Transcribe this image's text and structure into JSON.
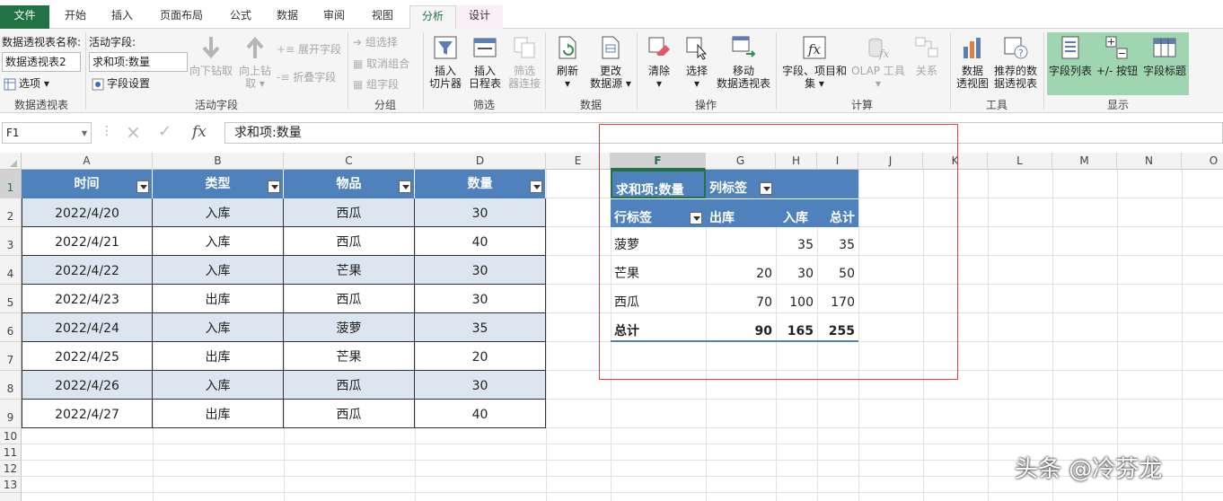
{
  "tabs": [
    "文件",
    "开始",
    "插入",
    "页面布局",
    "公式",
    "数据",
    "审阅",
    "视图",
    "分析",
    "设计"
  ],
  "ribbon": {
    "pivot_name_label": "数据透视表名称:",
    "pivot_name_value": "数据透视表2",
    "options_label": "选项",
    "group_pivot": "数据透视表",
    "active_field_label": "活动字段:",
    "active_field_value": "求和项:数量",
    "field_settings": "字段设置",
    "drill_down": "向下钻取",
    "drill_up_1": "向上钻",
    "drill_up_2": "取",
    "expand_field": "展开字段",
    "collapse_field": "折叠字段",
    "group_active_field": "活动字段",
    "group_selection": "组选择",
    "ungroup": "取消组合",
    "group_field": "组字段",
    "group_group": "分组",
    "insert_slicer_1": "插入",
    "insert_slicer_2": "切片器",
    "insert_timeline_1": "插入",
    "insert_timeline_2": "日程表",
    "filter_conn_1": "筛选",
    "filter_conn_2": "器连接",
    "group_filter": "筛选",
    "refresh": "刷新",
    "change_source_1": "更改",
    "change_source_2": "数据源",
    "group_data": "数据",
    "clear": "清除",
    "select": "选择",
    "move_1": "移动",
    "move_2": "数据透视表",
    "group_actions": "操作",
    "fields_items_1": "字段、项目和",
    "fields_items_2": "集",
    "olap_tools": "OLAP 工具",
    "relationships": "关系",
    "group_calc": "计算",
    "pivot_chart_1": "数据",
    "pivot_chart_2": "透视图",
    "recommended_1": "推荐的数",
    "recommended_2": "据透视表",
    "group_tools": "工具",
    "field_list": "字段列表",
    "plus_minus": "+/- 按钮",
    "field_headers": "字段标题",
    "group_show": "显示"
  },
  "formula_bar": {
    "name_box": "F1",
    "cancel_icon": "×",
    "enter_icon": "✓",
    "fx": "fx",
    "formula": "求和项:数量"
  },
  "columns": [
    "A",
    "B",
    "C",
    "D",
    "E",
    "F",
    "G",
    "H",
    "I",
    "J",
    "K",
    "L",
    "M",
    "N",
    "O"
  ],
  "rows": [
    "1",
    "2",
    "3",
    "4",
    "5",
    "6",
    "7",
    "8",
    "9",
    "10",
    "11",
    "12",
    "13"
  ],
  "source_table": {
    "headers": [
      "时间",
      "类型",
      "物品",
      "数量"
    ],
    "rows": [
      [
        "2022/4/20",
        "入库",
        "西瓜",
        "30"
      ],
      [
        "2022/4/21",
        "入库",
        "西瓜",
        "40"
      ],
      [
        "2022/4/22",
        "入库",
        "芒果",
        "30"
      ],
      [
        "2022/4/23",
        "出库",
        "西瓜",
        "30"
      ],
      [
        "2022/4/24",
        "入库",
        "菠萝",
        "35"
      ],
      [
        "2022/4/25",
        "出库",
        "芒果",
        "20"
      ],
      [
        "2022/4/26",
        "入库",
        "西瓜",
        "30"
      ],
      [
        "2022/4/27",
        "出库",
        "西瓜",
        "40"
      ]
    ]
  },
  "pivot": {
    "value_field": "求和项:数量",
    "col_labels": "列标签",
    "row_labels": "行标签",
    "col_headers": [
      "出库",
      "入库",
      "总计"
    ],
    "rows": [
      {
        "label": "菠萝",
        "out": "",
        "in": "35",
        "total": "35"
      },
      {
        "label": "芒果",
        "out": "20",
        "in": "30",
        "total": "50"
      },
      {
        "label": "西瓜",
        "out": "70",
        "in": "100",
        "total": "170"
      }
    ],
    "grand": {
      "label": "总计",
      "out": "90",
      "in": "165",
      "total": "255"
    }
  },
  "watermark": "头条 @冷芬龙",
  "colors": {
    "excel_green": "#217346",
    "table_blue": "#4f81bd",
    "band": "#dce6f1",
    "highlight": "#e0403f"
  }
}
